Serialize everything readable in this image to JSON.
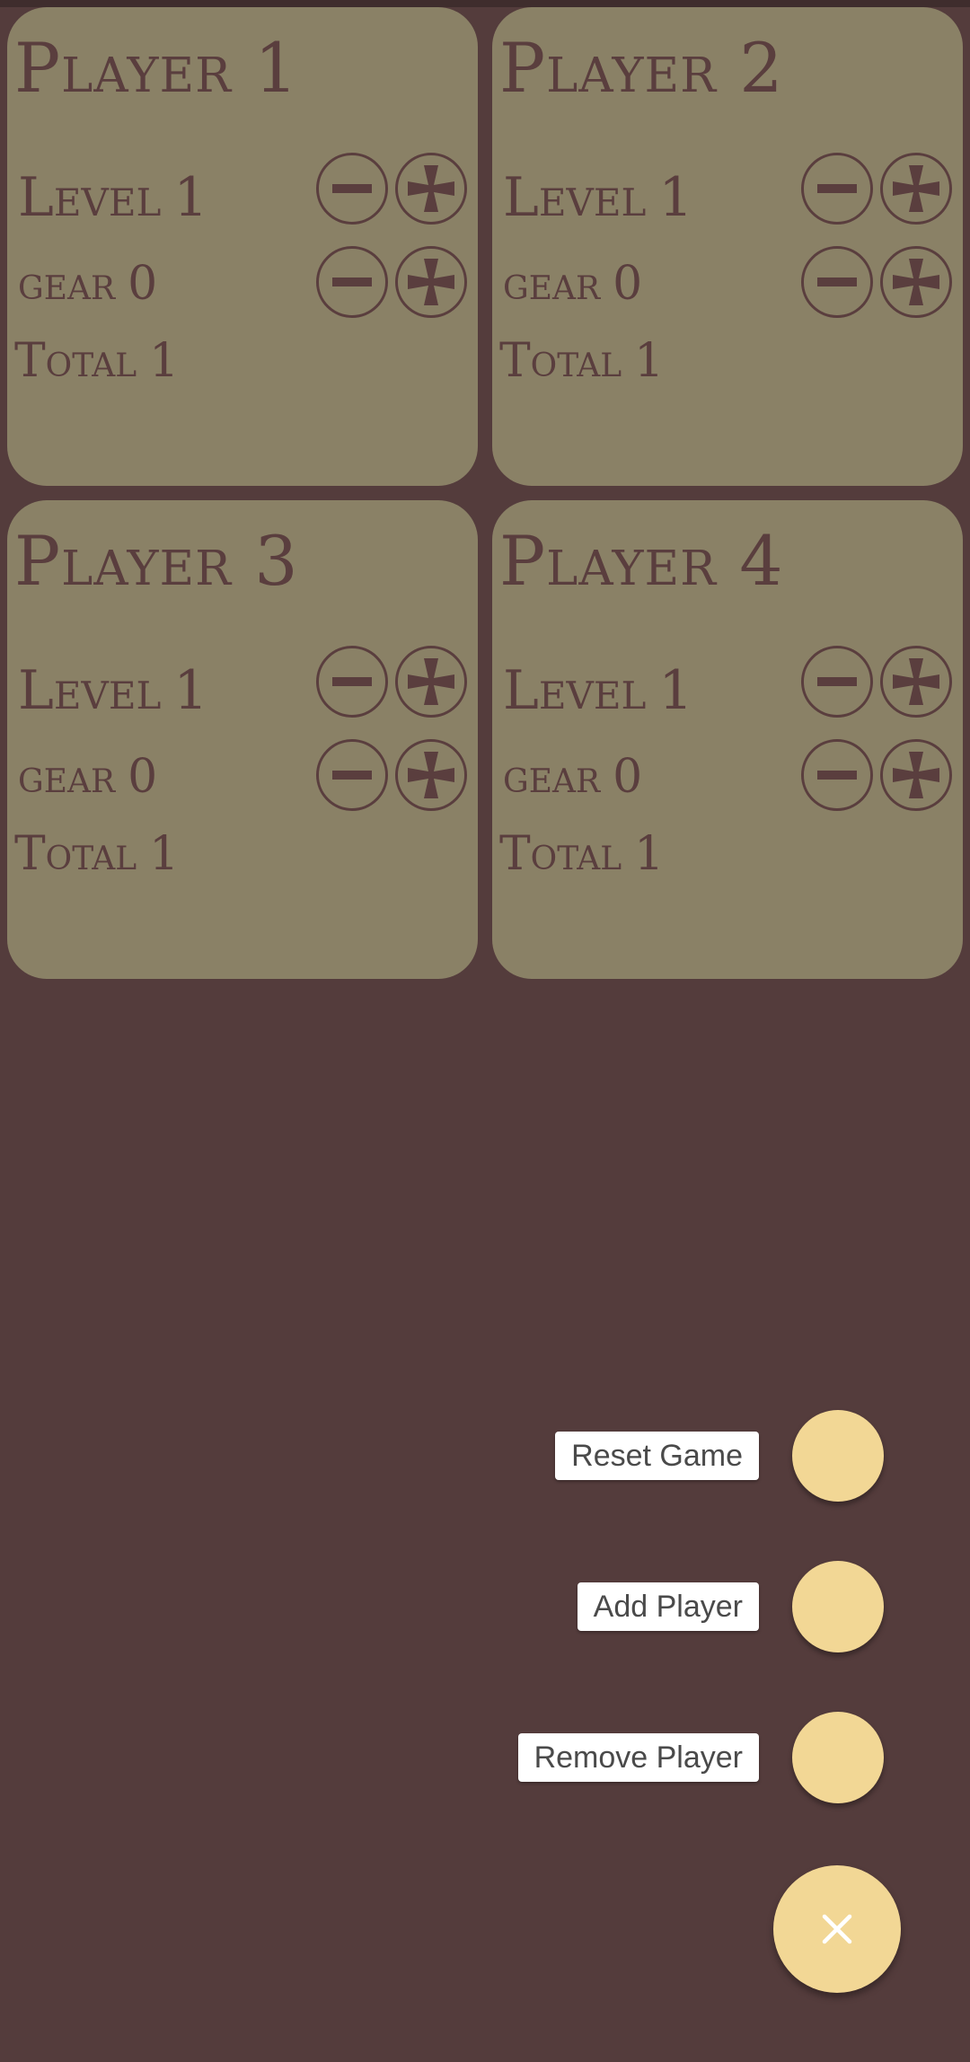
{
  "players": [
    {
      "title": "Player 1",
      "level_label": "Level",
      "level": "1",
      "gear_label": "gear",
      "gear": "0",
      "total_label": "Total",
      "total": "1"
    },
    {
      "title": "Player 2",
      "level_label": "Level",
      "level": "1",
      "gear_label": "gear",
      "gear": "0",
      "total_label": "Total",
      "total": "1"
    },
    {
      "title": "Player 3",
      "level_label": "Level",
      "level": "1",
      "gear_label": "gear",
      "gear": "0",
      "total_label": "Total",
      "total": "1"
    },
    {
      "title": "Player 4",
      "level_label": "Level",
      "level": "1",
      "gear_label": "gear",
      "gear": "0",
      "total_label": "Total",
      "total": "1"
    }
  ],
  "fab_menu": {
    "reset_label": "Reset Game",
    "add_label": "Add Player",
    "remove_label": "Remove Player",
    "close_icon": "close-icon"
  },
  "colors": {
    "background": "#543c3c",
    "card": "#8a8166",
    "text": "#5a3e3e",
    "fab": "#f2d795"
  }
}
